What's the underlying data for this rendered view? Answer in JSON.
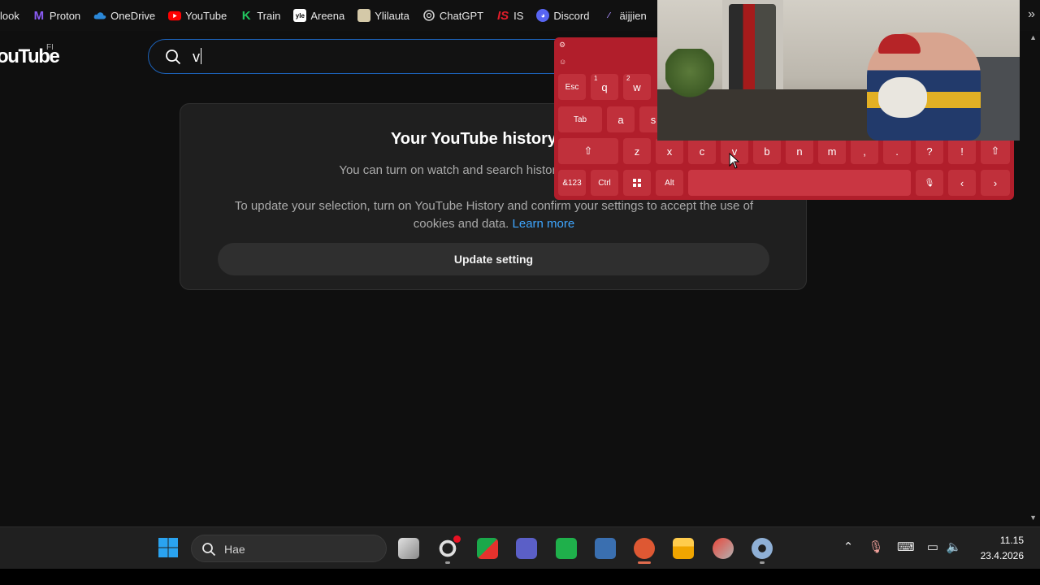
{
  "bookmarks": [
    {
      "label": "look",
      "icon": "outlook-icon",
      "color": ""
    },
    {
      "label": "Proton",
      "icon": "proton-icon",
      "color": "#8b5cf6"
    },
    {
      "label": "OneDrive",
      "icon": "onedrive-icon",
      "color": "#2b88d8"
    },
    {
      "label": "YouTube",
      "icon": "youtube-icon",
      "color": "#ff0000"
    },
    {
      "label": "Train",
      "icon": "train-icon",
      "color": "#22c55e"
    },
    {
      "label": "Areena",
      "icon": "yle-icon",
      "color": "#ffffff"
    },
    {
      "label": "Ylilauta",
      "icon": "ylilauta-icon",
      "color": "#d4c9a8"
    },
    {
      "label": "ChatGPT",
      "icon": "chatgpt-icon",
      "color": "#cfcfcf"
    },
    {
      "label": "IS",
      "icon": "is-icon",
      "color": "#e11d2a"
    },
    {
      "label": "Discord",
      "icon": "discord-icon",
      "color": "#5865f2"
    },
    {
      "label": "äijjien",
      "icon": "aijjien-icon",
      "color": "#a78bfa"
    }
  ],
  "youtube": {
    "logo_text": "ouTube",
    "region": "FI",
    "search_value": "v"
  },
  "history_card": {
    "title": "Your YouTube history",
    "line1": "You can turn on watch and search history at any time to g",
    "line2": "To update your selection, turn on YouTube History and confirm your settings to accept the use of cookies and data.",
    "learn_more": "Learn more",
    "button": "Update setting"
  },
  "keyboard": {
    "row1": [
      {
        "label": "Esc",
        "num": ""
      },
      {
        "label": "q",
        "num": "1"
      },
      {
        "label": "w",
        "num": "2"
      }
    ],
    "row2": [
      {
        "label": "Tab"
      },
      {
        "label": "a"
      },
      {
        "label": "s"
      }
    ],
    "row3": [
      {
        "label": "⇧"
      },
      {
        "label": "z"
      },
      {
        "label": "x"
      },
      {
        "label": "c"
      },
      {
        "label": "v"
      },
      {
        "label": "b"
      },
      {
        "label": "n"
      },
      {
        "label": "m"
      },
      {
        "label": ","
      },
      {
        "label": "."
      },
      {
        "label": "?"
      },
      {
        "label": "!"
      },
      {
        "label": "⇧"
      }
    ],
    "row4": [
      {
        "label": "&123"
      },
      {
        "label": "Ctrl"
      },
      {
        "label": ""
      },
      {
        "label": "Alt"
      },
      {
        "label": ""
      },
      {
        "label": "🎙"
      },
      {
        "label": "‹"
      },
      {
        "label": "›"
      }
    ]
  },
  "taskbar": {
    "search_placeholder": "Hae",
    "time": "11.15",
    "date": "23.4.2026"
  },
  "colors": {
    "youtube_bg": "#0f0f0f",
    "card_bg": "#1f1f1f",
    "keyboard_bg": "#b11e2b",
    "link": "#3ea6ff",
    "taskbar_bg": "#202020"
  }
}
